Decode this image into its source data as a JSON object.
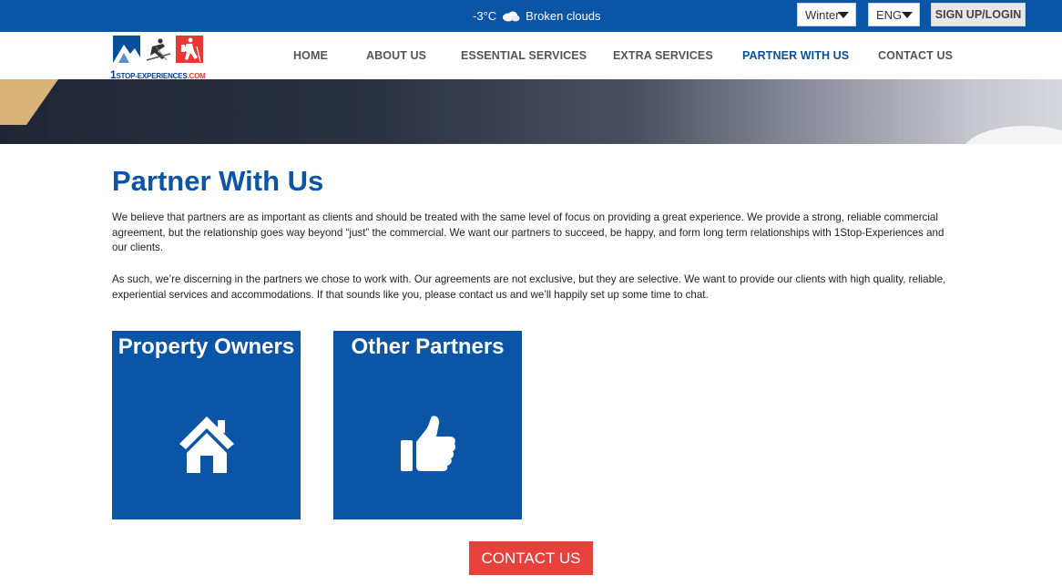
{
  "topbar": {
    "temperature": "-3°C",
    "weather_icon": "cloud-icon",
    "weather_text": "Broken clouds",
    "season_select": "Winter",
    "language_select": "ENG",
    "signup_label": "SIGN UP/LOGIN"
  },
  "logo": {
    "number": "1",
    "text_main": "STOP-EXPERIENCES",
    "text_suffix": ".COM"
  },
  "nav": {
    "items": [
      "HOME",
      "ABOUT US",
      "ESSENTIAL SERVICES",
      "EXTRA SERVICES",
      "PARTNER WITH US",
      "CONTACT US"
    ],
    "active": "PARTNER WITH US"
  },
  "main": {
    "title": "Partner With Us",
    "paragraph1": "We believe that partners are as important as clients and should be treated with the same level of focus on providing a great experience. We provide a strong, reliable commercial agreement, but the relationship goes way beyond “just” the commercial. We want our partners to succeed, be happy, and form long term relationships with 1Stop-Experiences and our clients.",
    "paragraph2": "As such, we’re discerning in the partners we chose to work with. Our agreements are not exclusive, but they are selective. We want to provide our clients with high quality, reliable, experiential services and accommodations. If that sounds like you, please contact us and we’ll happily set up some time to chat."
  },
  "cards": [
    {
      "title": "Property Owners",
      "icon": "home-icon"
    },
    {
      "title": "Other Partners",
      "icon": "thumbs-up-icon"
    }
  ],
  "contact_button": "CONTACT US",
  "colors": {
    "brand_blue": "#0a55a5",
    "contact_red": "#e8403a",
    "logo_red": "#e53a32"
  }
}
